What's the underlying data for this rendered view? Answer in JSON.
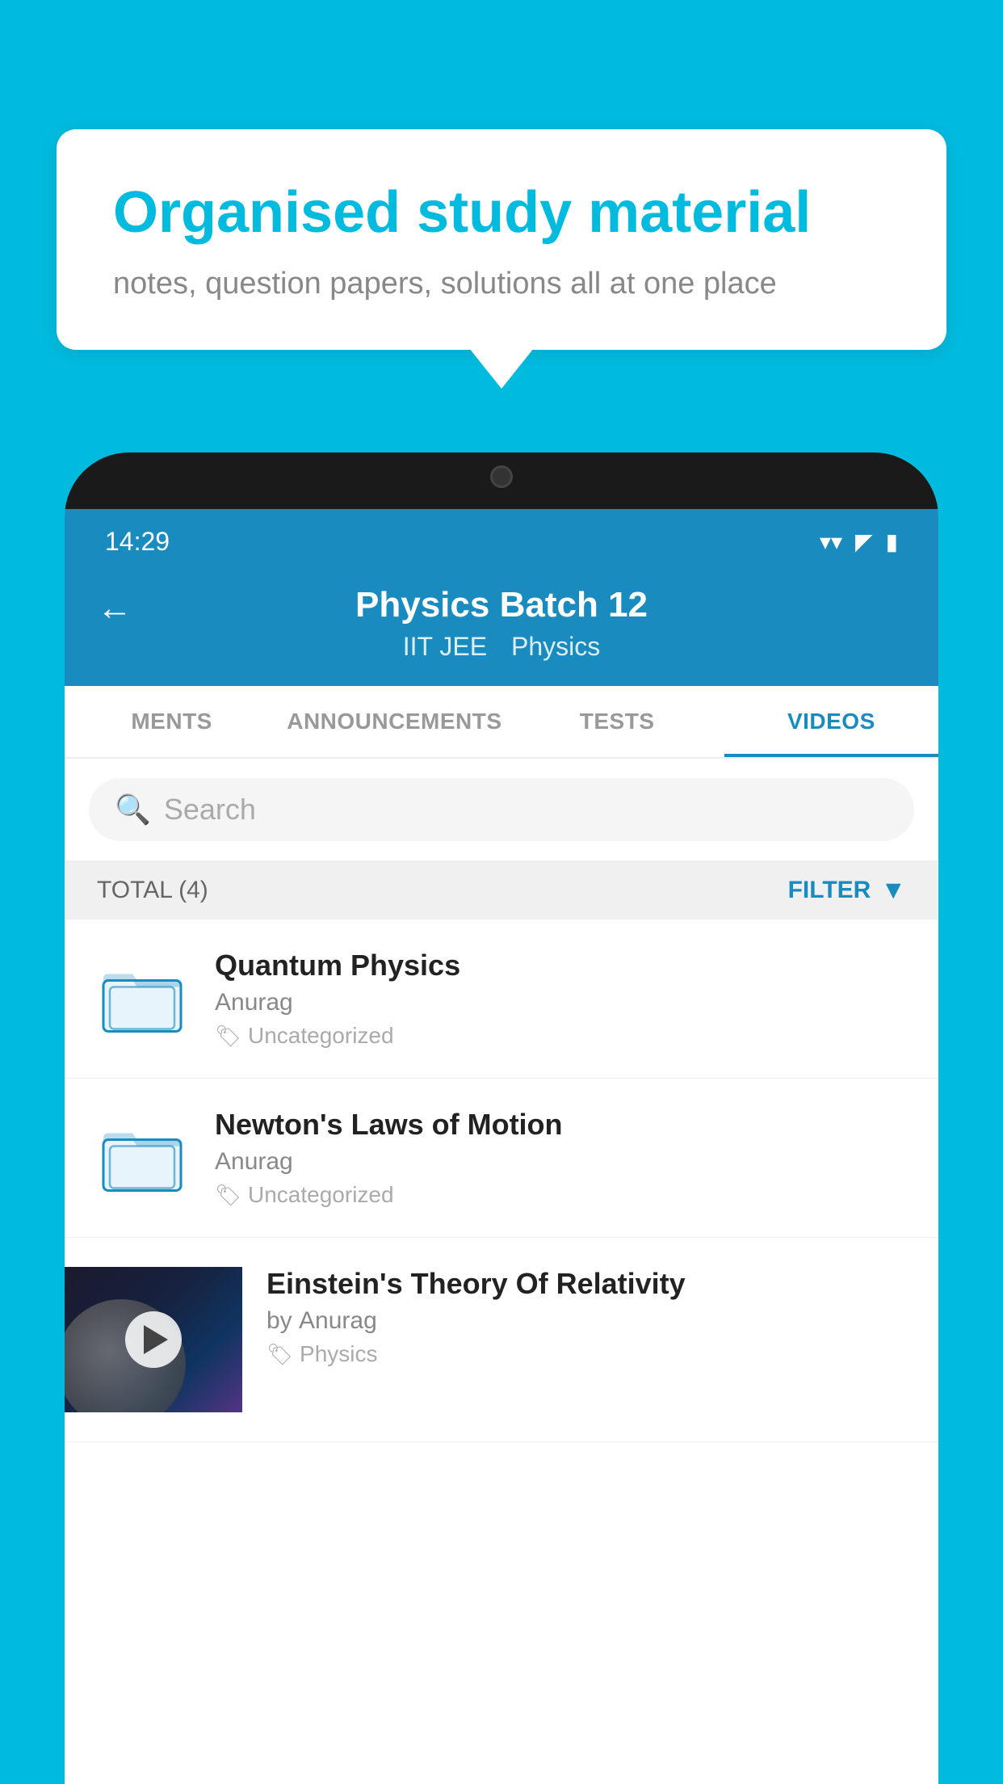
{
  "bubble": {
    "title": "Organised study material",
    "subtitle": "notes, question papers, solutions all at one place"
  },
  "statusBar": {
    "time": "14:29"
  },
  "header": {
    "backLabel": "←",
    "title": "Physics Batch 12",
    "tag1": "IIT JEE",
    "tag2": "Physics"
  },
  "tabs": [
    {
      "label": "MENTS",
      "active": false
    },
    {
      "label": "ANNOUNCEMENTS",
      "active": false
    },
    {
      "label": "TESTS",
      "active": false
    },
    {
      "label": "VIDEOS",
      "active": true
    }
  ],
  "search": {
    "placeholder": "Search"
  },
  "filterBar": {
    "totalLabel": "TOTAL (4)",
    "filterLabel": "FILTER"
  },
  "videos": [
    {
      "title": "Quantum Physics",
      "author": "Anurag",
      "tag": "Uncategorized",
      "hasThumb": false
    },
    {
      "title": "Newton's Laws of Motion",
      "author": "Anurag",
      "tag": "Uncategorized",
      "hasThumb": false
    },
    {
      "title": "Einstein's Theory Of Relativity",
      "authorPrefix": "by",
      "author": "Anurag",
      "tag": "Physics",
      "hasThumb": true
    }
  ]
}
